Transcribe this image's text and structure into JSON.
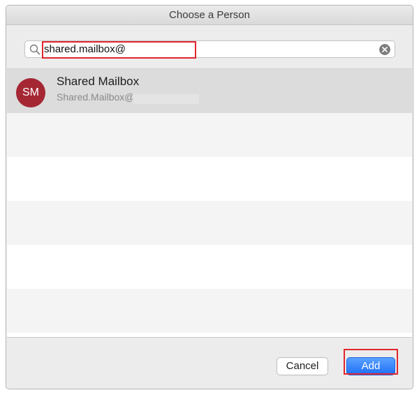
{
  "dialog": {
    "title": "Choose a Person"
  },
  "search": {
    "value": "shared.mailbox@",
    "icon": "search-icon",
    "clear_icon": "clear-icon"
  },
  "results": [
    {
      "initials": "SM",
      "name": "Shared Mailbox",
      "email": "Shared.Mailbox@",
      "avatar_color": "#a52734"
    }
  ],
  "buttons": {
    "cancel_label": "Cancel",
    "add_label": "Add"
  },
  "colors": {
    "highlight": "#e0262d",
    "accent": "#1e6ff6",
    "selected_row": "#dcdcdc"
  }
}
